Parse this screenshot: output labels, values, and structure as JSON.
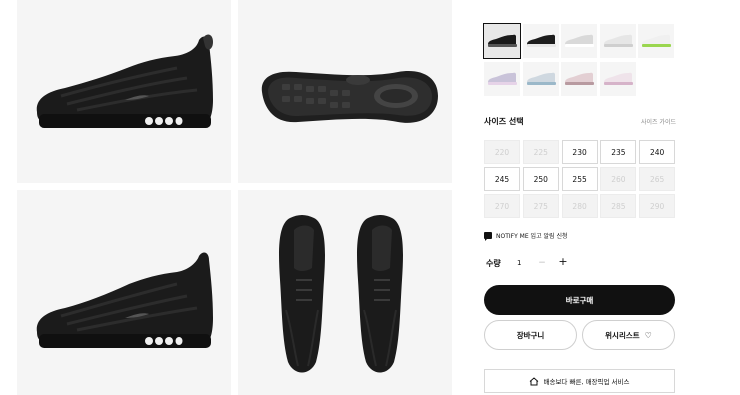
{
  "gallery": {
    "images": [
      {
        "name": "shoe-side-view-image",
        "view": "side-left"
      },
      {
        "name": "shoe-sole-view-image",
        "view": "sole"
      },
      {
        "name": "shoe-side-view-2-image",
        "view": "side-left-2"
      },
      {
        "name": "shoe-top-view-image",
        "view": "top"
      }
    ],
    "background_color": "#f5f5f5"
  },
  "colorways": [
    {
      "color": "#1a1a1a",
      "accent": "#555555",
      "selected": true
    },
    {
      "color": "#1d1d1d",
      "accent": "#e8e8e8",
      "selected": false
    },
    {
      "color": "#d9d9d9",
      "accent": "#ffffff",
      "selected": false
    },
    {
      "color": "#e6e6e6",
      "accent": "#cfcfcf",
      "selected": false
    },
    {
      "color": "#f0f0f0",
      "accent": "#9ad64f",
      "selected": false
    },
    {
      "color": "#c9c3d9",
      "accent": "#e6d3e8",
      "selected": false
    },
    {
      "color": "#cfd8e0",
      "accent": "#9bb8c9",
      "selected": false
    },
    {
      "color": "#e3cfd3",
      "accent": "#b89aa0",
      "selected": false
    },
    {
      "color": "#efe3ea",
      "accent": "#d6b3c9",
      "selected": false
    }
  ],
  "sizes": {
    "title": "사이즈 선택",
    "guide_label": "사이즈 가이드",
    "options": [
      {
        "label": "220",
        "available": false
      },
      {
        "label": "225",
        "available": false
      },
      {
        "label": "230",
        "available": true
      },
      {
        "label": "235",
        "available": true
      },
      {
        "label": "240",
        "available": true
      },
      {
        "label": "245",
        "available": true
      },
      {
        "label": "250",
        "available": true
      },
      {
        "label": "255",
        "available": true
      },
      {
        "label": "260",
        "available": false
      },
      {
        "label": "265",
        "available": false
      },
      {
        "label": "270",
        "available": false
      },
      {
        "label": "275",
        "available": false
      },
      {
        "label": "280",
        "available": false
      },
      {
        "label": "285",
        "available": false
      },
      {
        "label": "290",
        "available": false
      }
    ]
  },
  "notify": {
    "label": "NOTIFY ME 입고 알림 신청",
    "icon": "chat-icon"
  },
  "quantity": {
    "label": "수량",
    "value": "1",
    "minus": "−",
    "plus": "+"
  },
  "actions": {
    "buy_label": "바로구매",
    "cart_label": "장바구니",
    "wishlist_label": "위시리스트",
    "wishlist_icon": "♡"
  },
  "store_pickup": {
    "label": "배송보다 빠른, 매장픽업 서비스",
    "icon": "home-icon"
  }
}
